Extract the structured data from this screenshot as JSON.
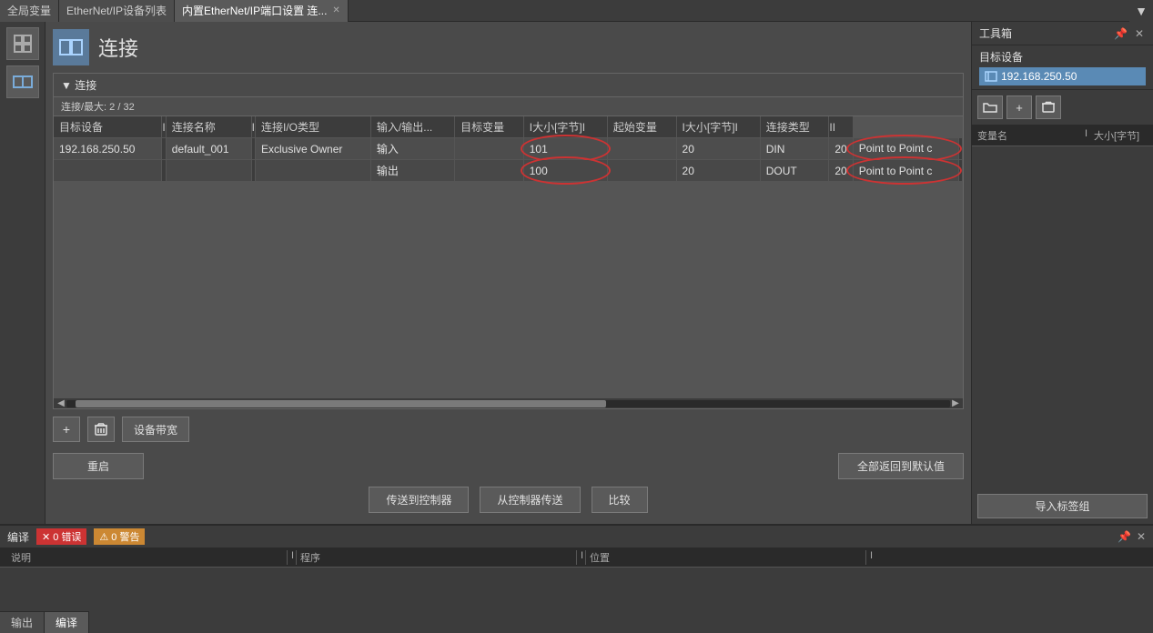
{
  "tabs": [
    {
      "id": "global-var",
      "label": "全局变量",
      "active": false,
      "closable": false
    },
    {
      "id": "ethernet-list",
      "label": "EtherNet/IP设备列表",
      "active": false,
      "closable": false
    },
    {
      "id": "ethernet-port",
      "label": "内置EtherNet/IP端口设置 连...",
      "active": true,
      "closable": true
    }
  ],
  "page": {
    "title": "连接",
    "icon_text": "⊞"
  },
  "connection_panel": {
    "header": "▼ 连接",
    "subheader": "连接/最大: 2 / 32",
    "columns": [
      "目标设备",
      "I",
      "连接名称",
      "I",
      "连接I/O类型",
      "输入/输出...",
      "目标变量",
      "I大小[字节]I",
      "起始变量",
      "I大小[字节]I",
      "连接类型",
      "II"
    ],
    "rows": [
      {
        "target_device": "192.168.250.50",
        "sep1": "",
        "connection_name": "default_001",
        "sep2": "",
        "io_type": "Exclusive Owner",
        "io_direction": "输入",
        "target_var": "",
        "input_size": "101",
        "start_var": "",
        "size_bytes": "20",
        "start_var2": "DIN",
        "size_bytes2": "20",
        "conn_type": "Point to Point c",
        "sep3": ""
      },
      {
        "target_device": "",
        "sep1": "",
        "connection_name": "",
        "sep2": "",
        "io_type": "",
        "io_direction": "输出",
        "target_var": "",
        "input_size": "100",
        "start_var": "",
        "size_bytes": "20",
        "start_var2": "DOUT",
        "size_bytes2": "20",
        "conn_type": "Point to Point c",
        "sep3": ""
      }
    ],
    "scrollbar": {
      "left_arrow": "◀",
      "right_arrow": "▶"
    }
  },
  "buttons": {
    "add": "+",
    "delete": "🗑",
    "device_bandwidth": "设备带宽",
    "reset": "重启",
    "restore_defaults": "全部返回到默认值",
    "transfer_to_controller": "传送到控制器",
    "transfer_from_controller": "从控制器传送",
    "compare": "比较"
  },
  "toolbox": {
    "title": "工具箱",
    "pin_btn": "📌",
    "close_btn": "✕",
    "target_device_label": "目标设备",
    "target_device_item": "192.168.250.50",
    "var_col1": "变量名",
    "var_col2": "I",
    "var_col3": "大小[字节]",
    "add_btn": "+",
    "delete_btn": "🗑",
    "folder_btn": "📁",
    "import_label": "导入标签组"
  },
  "compiler": {
    "title": "编译",
    "pin_btn": "📌",
    "close_btn": "✕",
    "error_badge": "0 错误",
    "warning_badge": "0 警告",
    "error_icon": "✕",
    "warning_icon": "⚠",
    "columns": [
      "说明",
      "I",
      "程序",
      "I",
      "位置",
      "I"
    ],
    "tabs": [
      {
        "label": "输出",
        "active": false
      },
      {
        "label": "编译",
        "active": true
      }
    ]
  }
}
